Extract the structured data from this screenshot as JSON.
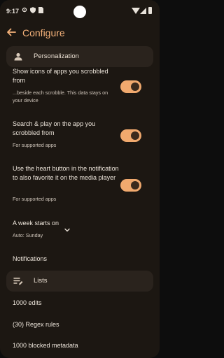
{
  "status_bar": {
    "time": "9:17",
    "icons": [
      "gear-icon",
      "shield-icon",
      "sim-icon",
      "wifi-icon",
      "signal-icon",
      "battery-icon"
    ]
  },
  "app_bar": {
    "title": "Configure",
    "back_icon": "arrow-back-icon"
  },
  "sections": [
    {
      "label": "Personalization",
      "icon": "person-icon"
    },
    {
      "label": "Lists",
      "icon": "list-edit-icon"
    }
  ],
  "settings": {
    "show_icons": {
      "title": "Show icons of apps you scrobbled from",
      "subtitle": "...beside each scrobble. This data stays on your device",
      "enabled": true
    },
    "search_play": {
      "title": "Search & play on the app you scrobbled from",
      "subtitle": "For supported apps",
      "enabled": true
    },
    "heart_button": {
      "title": "Use the heart button in the notification to also favorite it on the media player",
      "subtitle": "For supported apps",
      "enabled": true
    },
    "week_start": {
      "title": "A week starts on",
      "value": "Auto: Sunday"
    },
    "notifications": {
      "title": "Notifications"
    }
  },
  "lists": {
    "edits": "1000 edits",
    "regex": "(30) Regex rules",
    "blocked": "1000 blocked metadata"
  },
  "colors": {
    "accent": "#f5b27a",
    "switch_track": "#f0a96e",
    "background": "#1c1712",
    "section_bg": "#2a231d"
  }
}
